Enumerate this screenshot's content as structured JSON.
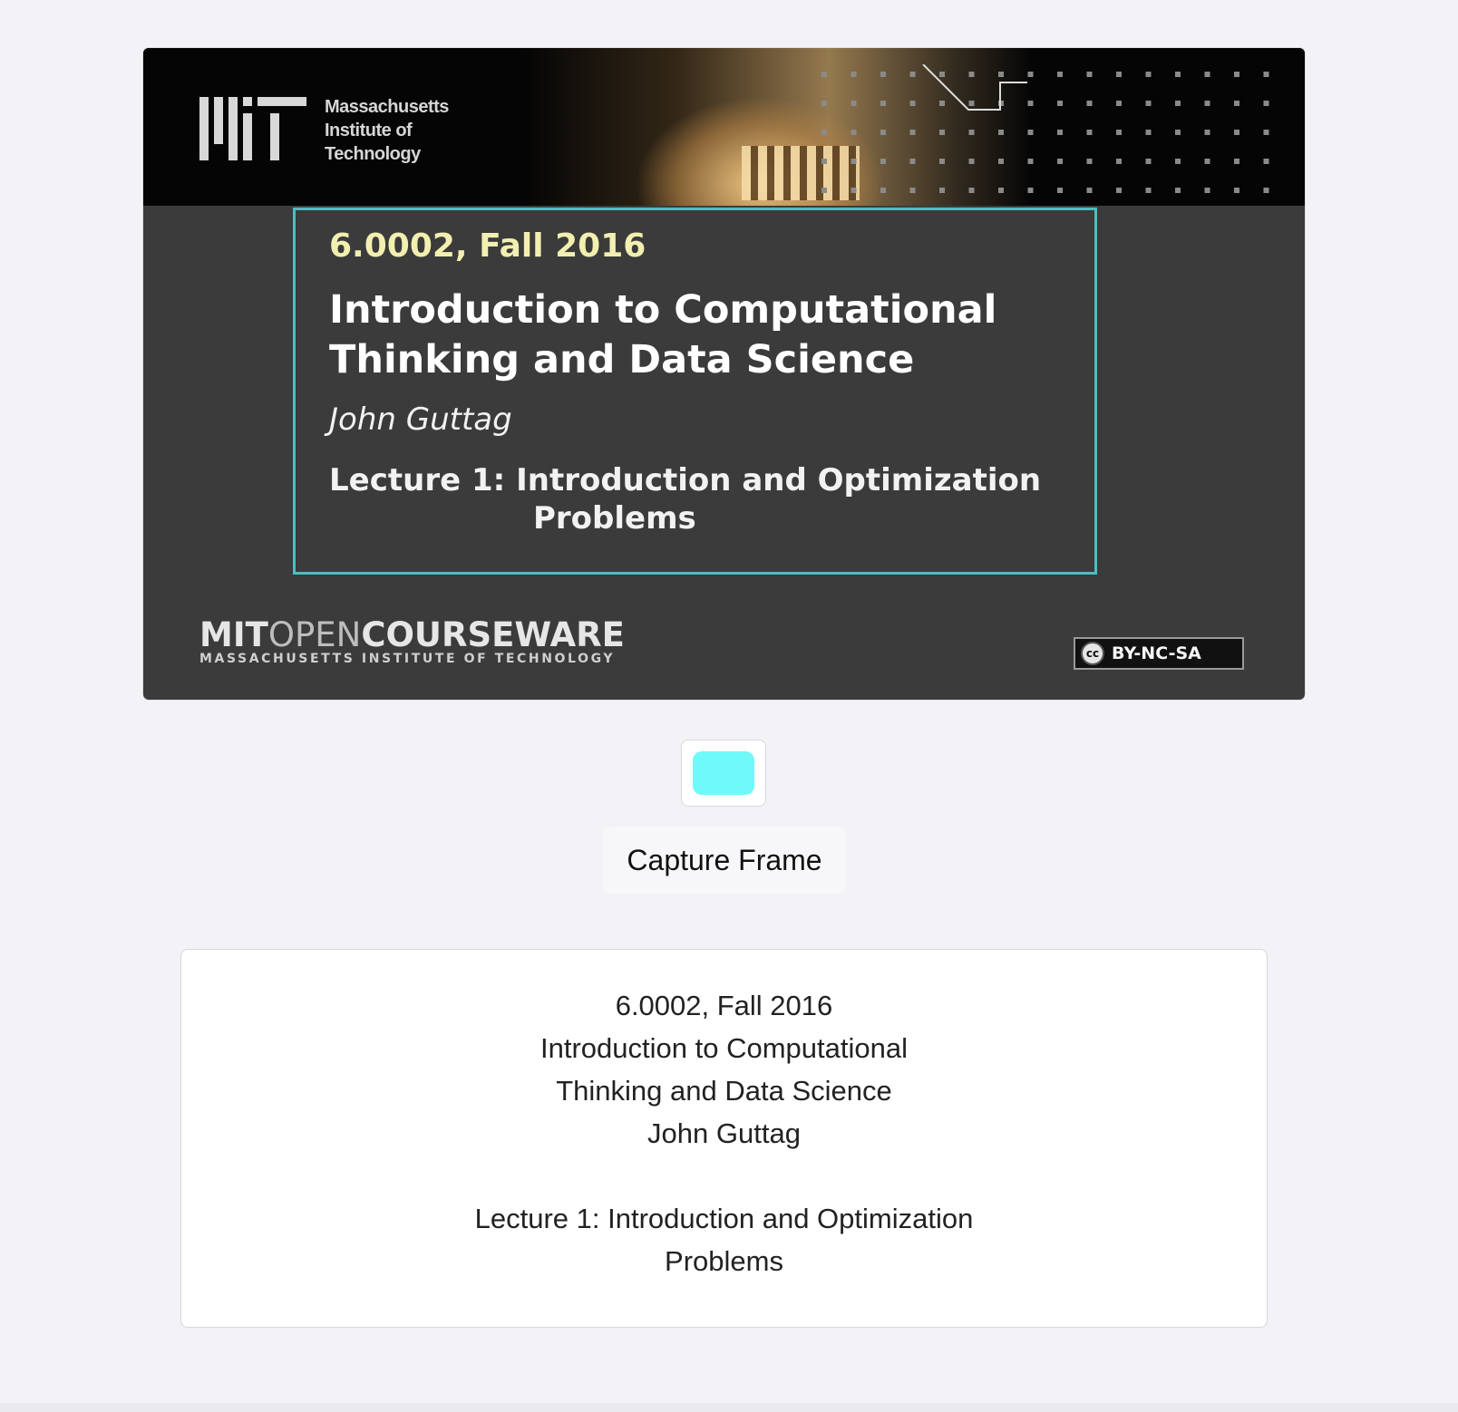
{
  "video": {
    "logo_words": [
      "Massachusetts",
      "Institute of",
      "Technology"
    ],
    "course": "6.0002, Fall 2016",
    "title_lines": [
      "Introduction to Computational",
      "Thinking and Data Science"
    ],
    "author": "John Guttag",
    "lecture_lines": [
      "Lecture 1: Introduction and Optimization",
      "Problems"
    ],
    "ocw_mit": "MIT",
    "ocw_open": "OPEN",
    "ocw_courseware": "COURSEWARE",
    "ocw_sub": "MASSACHUSETTS INSTITUTE OF TECHNOLOGY",
    "cc_symbol": "cc",
    "license": "BY-NC-SA"
  },
  "controls": {
    "swatch_color": "#6ff9fa",
    "capture_label": "Capture Frame"
  },
  "result": {
    "lines": [
      "6.0002, Fall 2016",
      "Introduction to Computational",
      "Thinking and Data Science",
      "John Guttag",
      "",
      "Lecture 1: Introduction and Optimization",
      "Problems"
    ]
  },
  "colors": {
    "page_bg": "#f2f2f7",
    "slide_bg": "#3b3b3b",
    "slide_border": "#4fbcc0",
    "course_text": "#f2efb0"
  }
}
